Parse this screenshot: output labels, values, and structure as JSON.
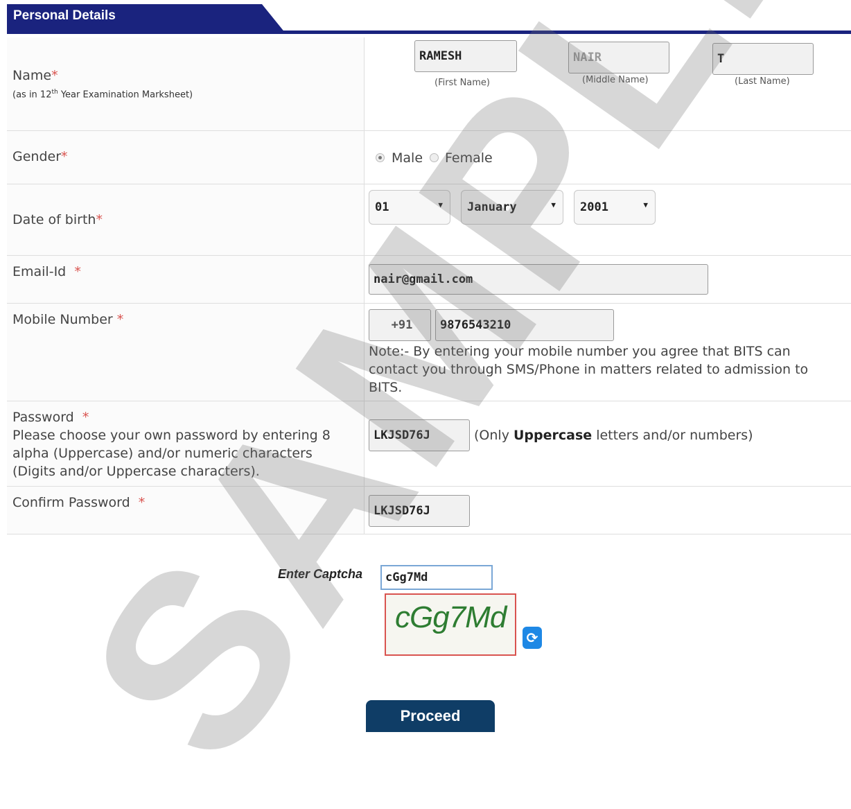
{
  "section": {
    "title": "Personal Details"
  },
  "fields": {
    "name": {
      "label": "Name",
      "required": "*",
      "hint_prefix": "(as in 12",
      "hint_sup": "th",
      "hint_suffix": " Year Examination Marksheet)",
      "first_value": "RAMESH",
      "first_caption": "(First Name)",
      "middle_value": "NAIR",
      "middle_caption": "(Middle Name)",
      "last_value": "T",
      "last_caption": "(Last Name)"
    },
    "gender": {
      "label": "Gender",
      "required": "*",
      "options": [
        "Male",
        "Female"
      ],
      "selected": "Male"
    },
    "dob": {
      "label": "Date of birth",
      "required": "*",
      "day": "01",
      "month": "January",
      "year": "2001"
    },
    "email": {
      "label": "Email-Id",
      "required": "*",
      "value": "nair@gmail.com"
    },
    "mobile": {
      "label": "Mobile Number",
      "required": "*",
      "code": "+91",
      "value": "9876543210",
      "note": "Note:- By entering your mobile number you agree that BITS can contact you through SMS/Phone in matters related to admission to BITS."
    },
    "password": {
      "label": "Password",
      "required": "*",
      "help": "Please choose your own password by entering 8 alpha (Uppercase) and/or numeric characters (Digits and/or Uppercase characters).",
      "value": "LKJSD76J",
      "rule_prefix": "(Only ",
      "rule_bold": "Uppercase",
      "rule_suffix": " letters and/or numbers)"
    },
    "confirm_password": {
      "label": "Confirm Password",
      "required": "*",
      "value": "LKJSD76J"
    }
  },
  "captcha": {
    "label": "Enter Captcha",
    "value": "cGg7Md",
    "image_text": "cGg7Md",
    "refresh_glyph": "⟳"
  },
  "actions": {
    "proceed_label": "Proceed"
  },
  "watermark": "SAMPLE",
  "colors": {
    "header": "#1a237e",
    "required": "#d9534f",
    "button": "#0f3d66",
    "captcha_text": "#2e7d32"
  }
}
